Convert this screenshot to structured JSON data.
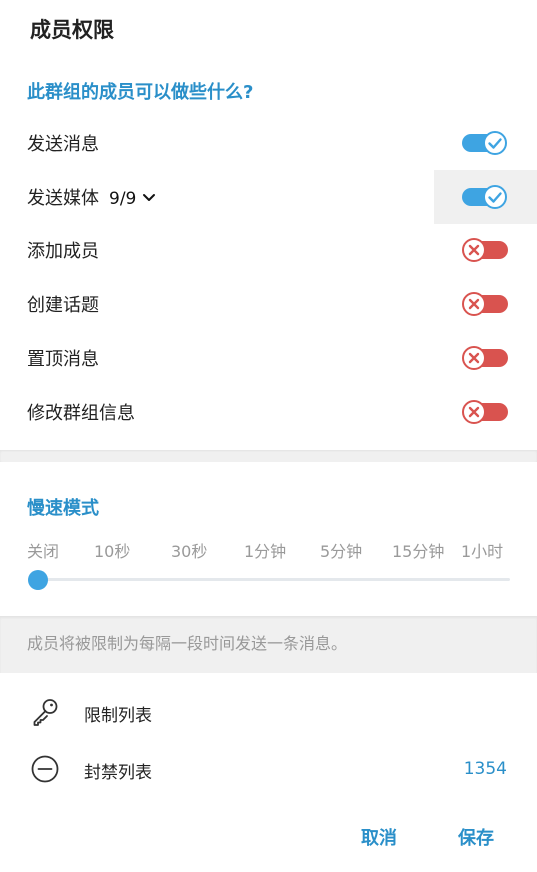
{
  "title": "成员权限",
  "permissions_header": "此群组的成员可以做些什么?",
  "permissions": [
    {
      "label": "发送消息",
      "enabled": true
    },
    {
      "label": "发送媒体",
      "count": "9/9",
      "enabled": true
    },
    {
      "label": "添加成员",
      "enabled": false
    },
    {
      "label": "创建话题",
      "enabled": false
    },
    {
      "label": "置顶消息",
      "enabled": false
    },
    {
      "label": "修改群组信息",
      "enabled": false
    }
  ],
  "slow_mode": {
    "header": "慢速模式",
    "options": [
      "关闭",
      "10秒",
      "30秒",
      "1分钟",
      "5分钟",
      "15分钟",
      "1小时"
    ],
    "selected": "关闭",
    "hint": "成员将被限制为每隔一段时间发送一条消息。"
  },
  "lists": [
    {
      "label": "限制列表",
      "icon": "key-icon"
    },
    {
      "label": "封禁列表",
      "icon": "minus-circle-icon",
      "count": "1354"
    }
  ],
  "actions": {
    "cancel": "取消",
    "save": "保存"
  },
  "colors": {
    "accent": "#2a8fc9",
    "toggle_on": "#3ea4e2",
    "toggle_off": "#d9534f"
  }
}
